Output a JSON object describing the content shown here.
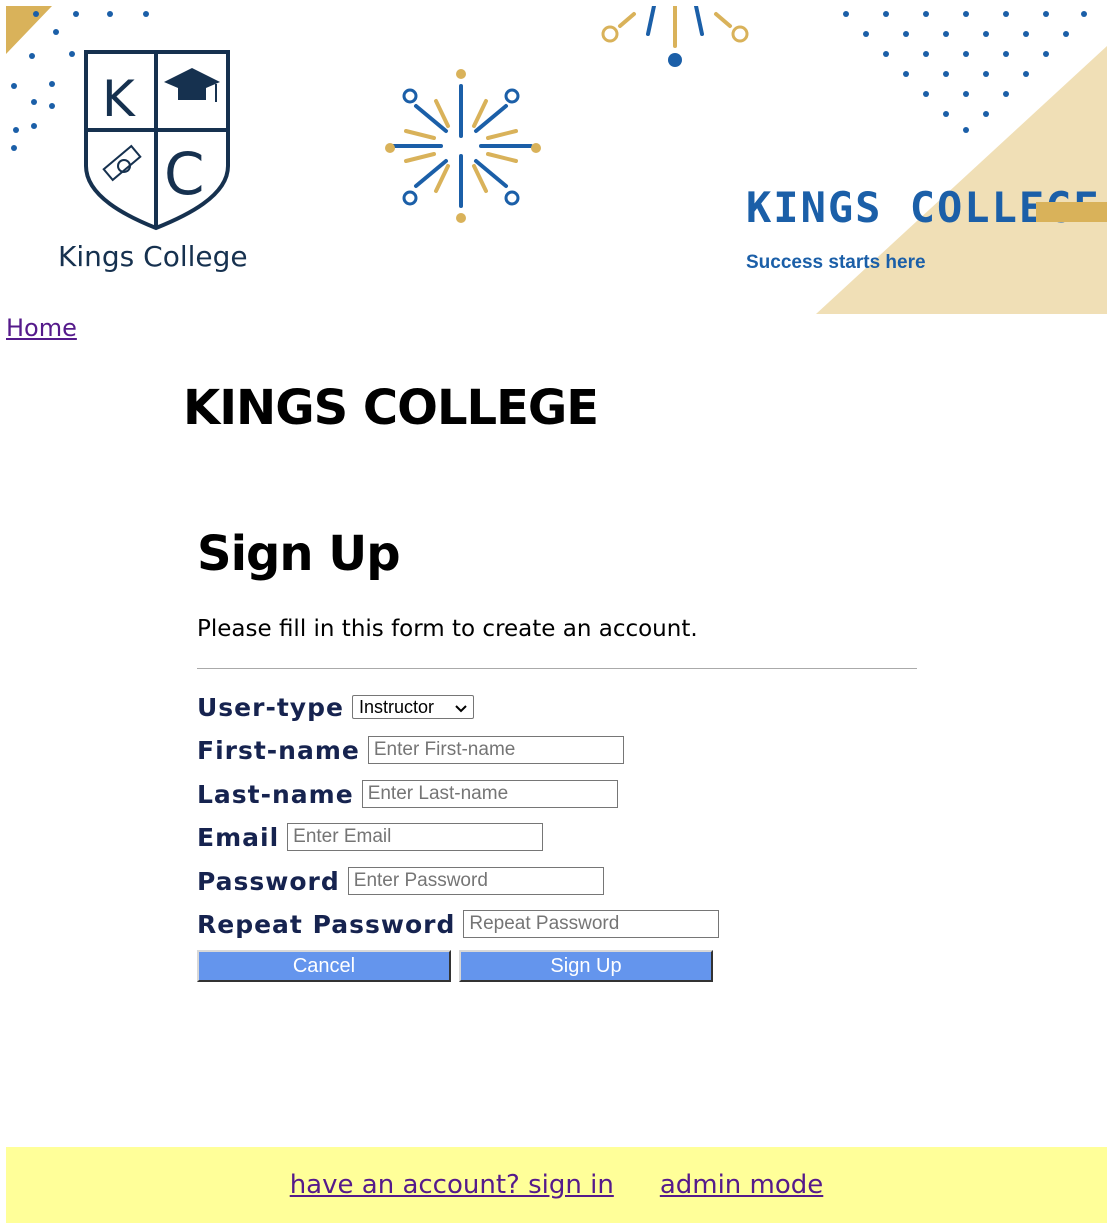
{
  "banner": {
    "logo_letters": [
      "K",
      "C"
    ],
    "logo_text": "Kings College",
    "brand_title": "KINGS COLLEGE",
    "tagline": "Success starts here",
    "colors": {
      "navy": "#16314f",
      "gold": "#d9b25a",
      "blue": "#1b5fa8",
      "cream": "#f0dfb6"
    }
  },
  "nav": {
    "home": "Home"
  },
  "site_title": "KINGS COLLEGE",
  "form": {
    "title": "Sign Up",
    "description": "Please fill in this form to create an account.",
    "user_type": {
      "label": "User-type",
      "selected": "Instructor"
    },
    "first_name": {
      "label": "First-name",
      "placeholder": "Enter First-name"
    },
    "last_name": {
      "label": "Last-name",
      "placeholder": "Enter Last-name"
    },
    "email": {
      "label": "Email",
      "placeholder": "Enter Email"
    },
    "password": {
      "label": "Password",
      "placeholder": "Enter Password"
    },
    "repeat_password": {
      "label": "Repeat Password",
      "placeholder": "Repeat Password"
    },
    "cancel": "Cancel",
    "signup": "Sign Up",
    "button_color": "#6495ed"
  },
  "footer": {
    "signin": "have an account? sign in",
    "admin": "admin mode",
    "background": "#ffff99"
  }
}
